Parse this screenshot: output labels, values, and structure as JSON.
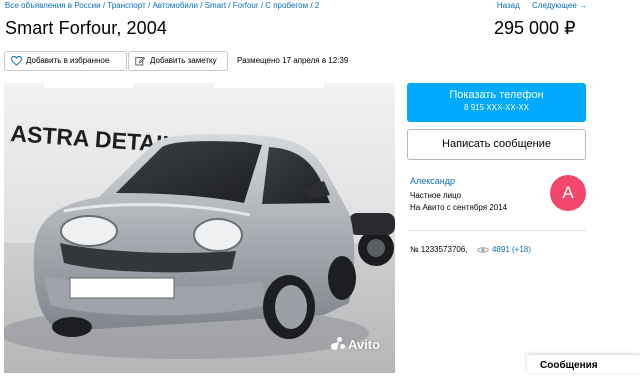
{
  "breadcrumb": {
    "items": [
      "Все объявления в России",
      "Транспорт",
      "Автомобили",
      "Smart",
      "Forfour",
      "С пробегом",
      "2"
    ],
    "separator": "/"
  },
  "pager": {
    "back": "Назад",
    "next": "Следующее →"
  },
  "listing": {
    "title": "Smart Forfour, 2004",
    "price": "295 000 ₽",
    "photo_watermark": "Avito",
    "photo_wall_text": "ASTRA DETAILING",
    "photo_plate_text": "",
    "posted": "Размещено 17 апреля в 12:39",
    "ad_number": "№ 1233573706,",
    "views": "4891 (+18)"
  },
  "actions": {
    "favorite_label": "Добавить в избранное",
    "note_label": "Добавить заметку",
    "favorite_icon": "heart-icon",
    "note_icon": "note-edit-icon"
  },
  "contact": {
    "phone_label": "Показать телефон",
    "phone_number": "8 915 XXX-XX-XX",
    "message_label": "Написать сообщение"
  },
  "seller": {
    "name": "Александр",
    "type": "Частное лицо",
    "since": "На Авито с сентября 2014",
    "avatar_letter": "А"
  },
  "messenger": {
    "tab_label": "Сообщения"
  },
  "colors": {
    "link": "#0a6ebd",
    "primary_button": "#00aaff",
    "avatar": "#f2466b"
  }
}
